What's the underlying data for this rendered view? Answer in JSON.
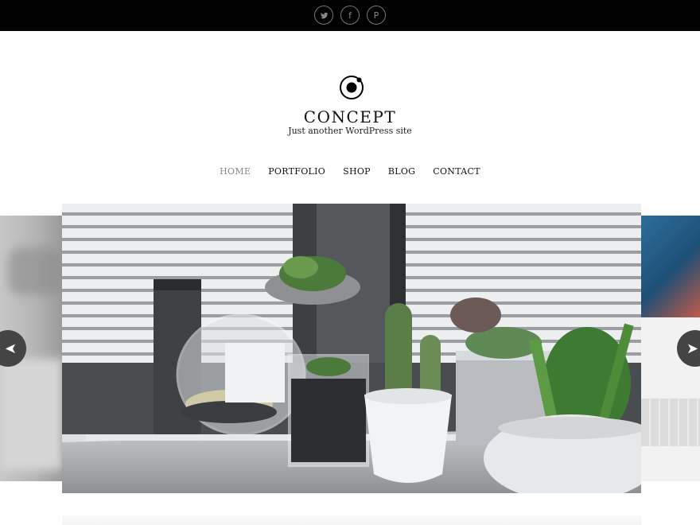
{
  "social": [
    {
      "name": "twitter",
      "icon": "twitter-icon"
    },
    {
      "name": "facebook",
      "icon": "facebook-icon",
      "glyph": "f"
    },
    {
      "name": "pinterest",
      "icon": "pinterest-icon",
      "glyph": "P"
    }
  ],
  "site": {
    "title": "CONCEPT",
    "tagline": "Just another WordPress site"
  },
  "nav": {
    "items": [
      {
        "label": "HOME",
        "active": true
      },
      {
        "label": "PORTFOLIO",
        "active": false
      },
      {
        "label": "SHOP",
        "active": false
      },
      {
        "label": "BLOG",
        "active": false
      },
      {
        "label": "CONTACT",
        "active": false
      }
    ]
  },
  "slider": {
    "prev_glyph": "➤",
    "next_glyph": "➤",
    "current_image": "succulents-window-photo"
  },
  "colors": {
    "topbar": "#000000",
    "social_border": "#777777",
    "nav_active": "#888888",
    "arrow_bg": "#444444"
  }
}
